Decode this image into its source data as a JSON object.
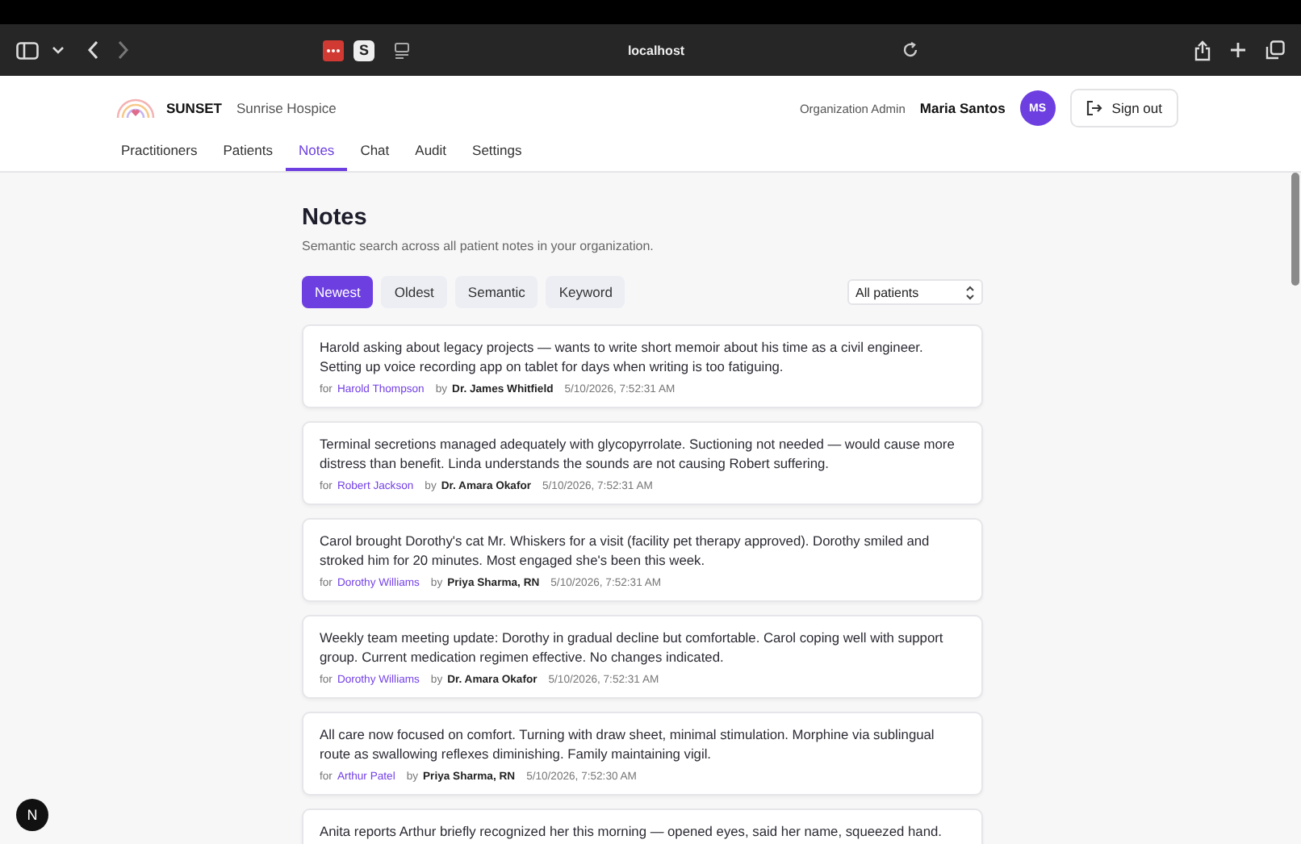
{
  "browser": {
    "address": "localhost",
    "tab_icon_letter": "S"
  },
  "header": {
    "brand": "SUNSET",
    "organization": "Sunrise Hospice",
    "role": "Organization Admin",
    "user_name": "Maria Santos",
    "avatar_initials": "MS",
    "sign_out": "Sign out"
  },
  "nav_tabs": [
    {
      "label": "Practitioners",
      "selected": false
    },
    {
      "label": "Patients",
      "selected": false
    },
    {
      "label": "Notes",
      "selected": true
    },
    {
      "label": "Chat",
      "selected": false
    },
    {
      "label": "Audit",
      "selected": false
    },
    {
      "label": "Settings",
      "selected": false
    }
  ],
  "page": {
    "title": "Notes",
    "subtitle": "Semantic search across all patient notes in your organization."
  },
  "sort_buttons": [
    {
      "label": "Newest",
      "selected": true
    },
    {
      "label": "Oldest",
      "selected": false
    },
    {
      "label": "Semantic",
      "selected": false
    },
    {
      "label": "Keyword",
      "selected": false
    }
  ],
  "patient_filter": {
    "value": "All patients"
  },
  "notes": [
    {
      "text": "Harold asking about legacy projects — wants to write short memoir about his time as a civil engineer. Setting up voice recording app on tablet for days when writing is too fatiguing.",
      "for_label": "for",
      "patient": "Harold Thompson",
      "by_label": "by",
      "author": "Dr. James Whitfield",
      "time": "5/10/2026, 7:52:31 AM"
    },
    {
      "text": "Terminal secretions managed adequately with glycopyrrolate. Suctioning not needed — would cause more distress than benefit. Linda understands the sounds are not causing Robert suffering.",
      "for_label": "for",
      "patient": "Robert Jackson",
      "by_label": "by",
      "author": "Dr. Amara Okafor",
      "time": "5/10/2026, 7:52:31 AM"
    },
    {
      "text": "Carol brought Dorothy's cat Mr. Whiskers for a visit (facility pet therapy approved). Dorothy smiled and stroked him for 20 minutes. Most engaged she's been this week.",
      "for_label": "for",
      "patient": "Dorothy Williams",
      "by_label": "by",
      "author": "Priya Sharma, RN",
      "time": "5/10/2026, 7:52:31 AM"
    },
    {
      "text": "Weekly team meeting update: Dorothy in gradual decline but comfortable. Carol coping well with support group. Current medication regimen effective. No changes indicated.",
      "for_label": "for",
      "patient": "Dorothy Williams",
      "by_label": "by",
      "author": "Dr. Amara Okafor",
      "time": "5/10/2026, 7:52:31 AM"
    },
    {
      "text": "All care now focused on comfort. Turning with draw sheet, minimal stimulation. Morphine via sublingual route as swallowing reflexes diminishing. Family maintaining vigil.",
      "for_label": "for",
      "patient": "Arthur Patel",
      "by_label": "by",
      "author": "Priya Sharma, RN",
      "time": "5/10/2026, 7:52:30 AM"
    },
    {
      "text": "Anita reports Arthur briefly recognized her this morning — opened eyes, said her name, squeezed hand."
    }
  ],
  "dev_badge": {
    "letter": "N"
  }
}
